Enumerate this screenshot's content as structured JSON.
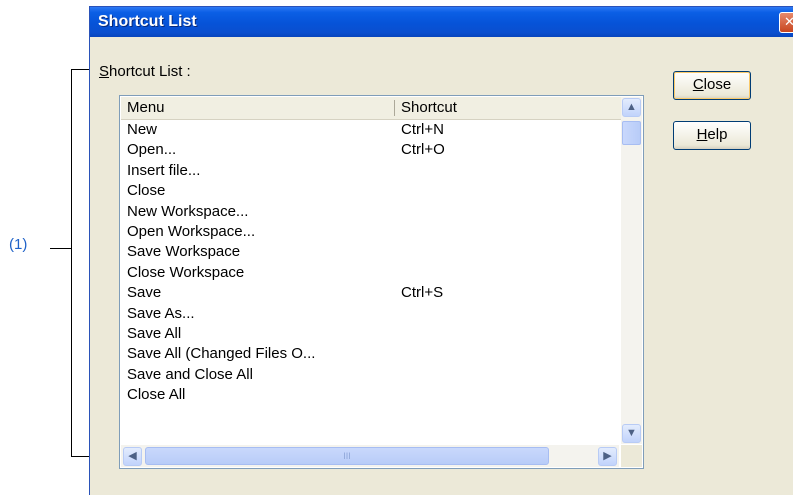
{
  "annotation": {
    "callout_label": "(1)"
  },
  "dialog": {
    "title": "Shortcut List",
    "close_glyph": "✕",
    "group_label_accel": "S",
    "group_label_rest": "hortcut List :",
    "buttons": {
      "close_accel": "C",
      "close_rest": "lose",
      "help_accel": "H",
      "help_rest": "elp"
    }
  },
  "list": {
    "columns": [
      "Menu",
      "Shortcut"
    ],
    "rows": [
      {
        "menu": "New",
        "shortcut": "Ctrl+N"
      },
      {
        "menu": "Open...",
        "shortcut": "Ctrl+O"
      },
      {
        "menu": "Insert file...",
        "shortcut": ""
      },
      {
        "menu": "Close",
        "shortcut": ""
      },
      {
        "menu": "New Workspace...",
        "shortcut": ""
      },
      {
        "menu": "Open Workspace...",
        "shortcut": ""
      },
      {
        "menu": "Save Workspace",
        "shortcut": ""
      },
      {
        "menu": "Close Workspace",
        "shortcut": ""
      },
      {
        "menu": "Save",
        "shortcut": "Ctrl+S"
      },
      {
        "menu": "Save As...",
        "shortcut": ""
      },
      {
        "menu": "Save All",
        "shortcut": ""
      },
      {
        "menu": "Save All (Changed Files O...",
        "shortcut": ""
      },
      {
        "menu": "Save and Close All",
        "shortcut": ""
      },
      {
        "menu": "Close All",
        "shortcut": ""
      }
    ]
  },
  "scroll": {
    "up_icon": "chevron-up-icon",
    "down_icon": "chevron-down-icon",
    "left_icon": "chevron-left-icon",
    "right_icon": "chevron-right-icon",
    "grip": "III"
  },
  "colors": {
    "title_bar": "#0653d8",
    "callout": "#1f62c8",
    "dialog_bg": "#ece9d8"
  }
}
